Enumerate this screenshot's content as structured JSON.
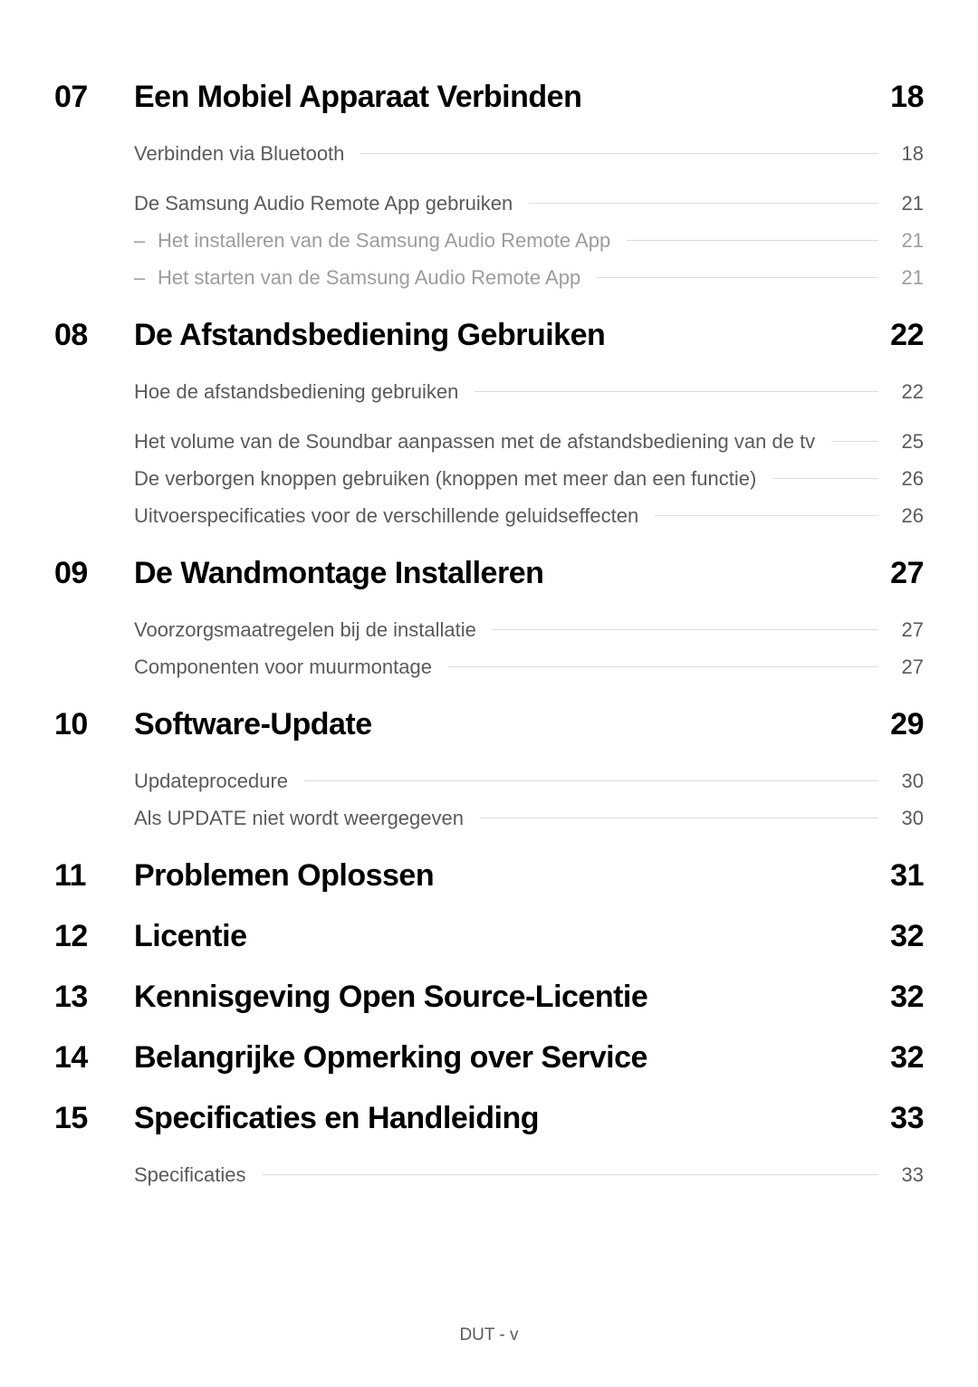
{
  "sections": [
    {
      "num": "07",
      "title": "Een Mobiel Apparaat Verbinden",
      "page": "18",
      "groups": [
        [
          {
            "label": "Verbinden via Bluetooth",
            "page": "18"
          }
        ],
        [
          {
            "label": "De Samsung Audio Remote App gebruiken",
            "page": "21"
          },
          {
            "label": "Het installeren van de Samsung Audio Remote App",
            "page": "21",
            "child": true
          },
          {
            "label": "Het starten van de Samsung Audio Remote App",
            "page": "21",
            "child": true
          }
        ]
      ]
    },
    {
      "num": "08",
      "title": "De Afstandsbediening Gebruiken",
      "page": "22",
      "groups": [
        [
          {
            "label": "Hoe de afstandsbediening gebruiken",
            "page": "22"
          }
        ],
        [
          {
            "label": "Het volume van de Soundbar aanpassen met de afstandsbediening van de tv",
            "page": "25"
          },
          {
            "label": "De verborgen knoppen gebruiken (knoppen met meer dan een functie)",
            "page": "26"
          },
          {
            "label": "Uitvoerspecificaties voor de verschillende geluidseffecten",
            "page": "26"
          }
        ]
      ]
    },
    {
      "num": "09",
      "title": "De Wandmontage Installeren",
      "page": "27",
      "groups": [
        [
          {
            "label": "Voorzorgsmaatregelen bij de installatie",
            "page": "27"
          },
          {
            "label": "Componenten voor muurmontage",
            "page": "27"
          }
        ]
      ]
    },
    {
      "num": "10",
      "title": "Software-Update",
      "page": "29",
      "groups": [
        [
          {
            "label": "Updateprocedure",
            "page": "30"
          },
          {
            "label": "Als UPDATE niet wordt weergegeven",
            "page": "30"
          }
        ]
      ]
    },
    {
      "num": "11",
      "title": "Problemen Oplossen",
      "page": "31",
      "groups": []
    },
    {
      "num": "12",
      "title": "Licentie",
      "page": "32",
      "groups": []
    },
    {
      "num": "13",
      "title": "Kennisgeving Open Source-Licentie",
      "page": "32",
      "groups": []
    },
    {
      "num": "14",
      "title": "Belangrijke Opmerking over Service",
      "page": "32",
      "groups": []
    },
    {
      "num": "15",
      "title": "Specificaties en Handleiding",
      "page": "33",
      "groups": [
        [
          {
            "label": "Specificaties",
            "page": "33"
          }
        ]
      ]
    }
  ],
  "footer": "DUT - v"
}
